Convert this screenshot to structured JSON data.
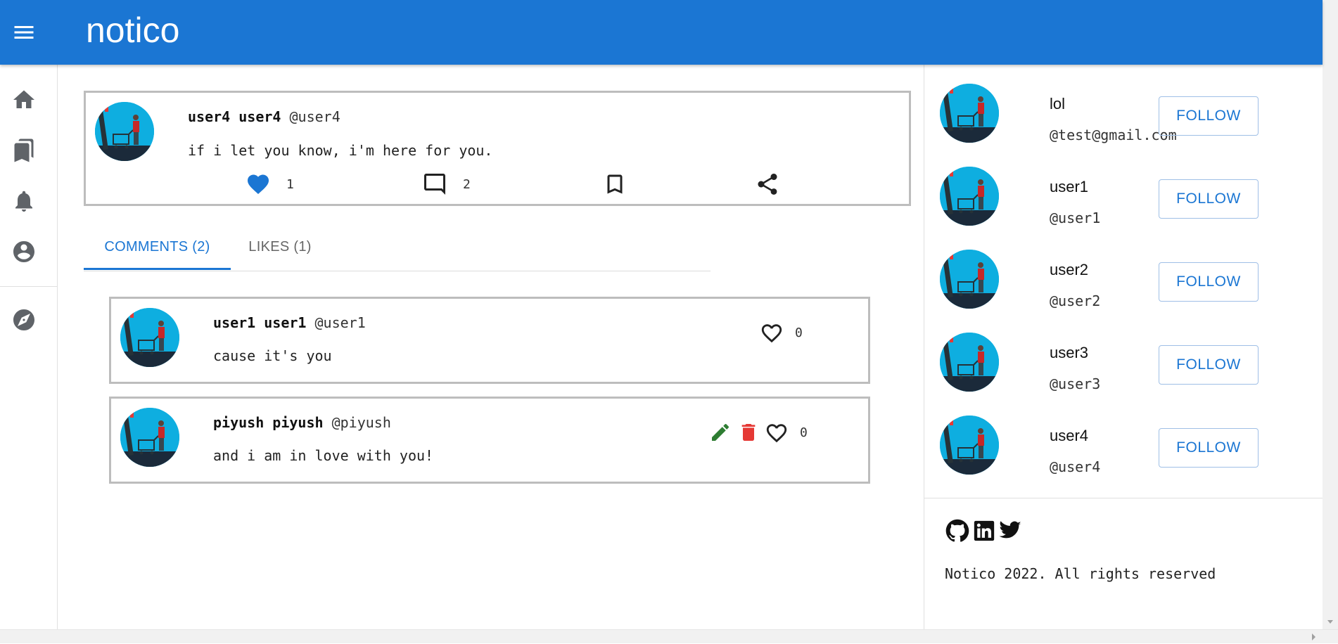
{
  "app": {
    "title": "notico"
  },
  "sidebar": {
    "items": [
      {
        "icon": "home-icon"
      },
      {
        "icon": "bookmarks-icon"
      },
      {
        "icon": "bell-icon"
      },
      {
        "icon": "account-circle-icon"
      },
      {
        "icon": "explore-icon"
      }
    ]
  },
  "post": {
    "name": "user4 user4",
    "handle": "@user4",
    "text": "if i let you know, i'm here for you.",
    "likes": "1",
    "comments": "2"
  },
  "tabs": [
    {
      "label": "COMMENTS (2)"
    },
    {
      "label": "LIKES (1)"
    }
  ],
  "comments": [
    {
      "name": "user1 user1",
      "handle": "@user1",
      "text": "cause it's you",
      "likes": "0"
    },
    {
      "name": "piyush piyush",
      "handle": "@piyush",
      "text": "and i am in love with you!",
      "likes": "0"
    }
  ],
  "suggestions": [
    {
      "name": "lol",
      "handle": "@test@gmail.com",
      "button": "FOLLOW"
    },
    {
      "name": "user1",
      "handle": "@user1",
      "button": "FOLLOW"
    },
    {
      "name": "user2",
      "handle": "@user2",
      "button": "FOLLOW"
    },
    {
      "name": "user3",
      "handle": "@user3",
      "button": "FOLLOW"
    },
    {
      "name": "user4",
      "handle": "@user4",
      "button": "FOLLOW"
    }
  ],
  "footer": {
    "text": "Notico 2022. All rights reserved",
    "icons": [
      "github-icon",
      "linkedin-icon",
      "twitter-icon"
    ]
  },
  "colors": {
    "primary": "#1b76d3",
    "edit": "#2e7d32",
    "delete": "#e53935",
    "avatar_bg": "#0eaee0"
  }
}
